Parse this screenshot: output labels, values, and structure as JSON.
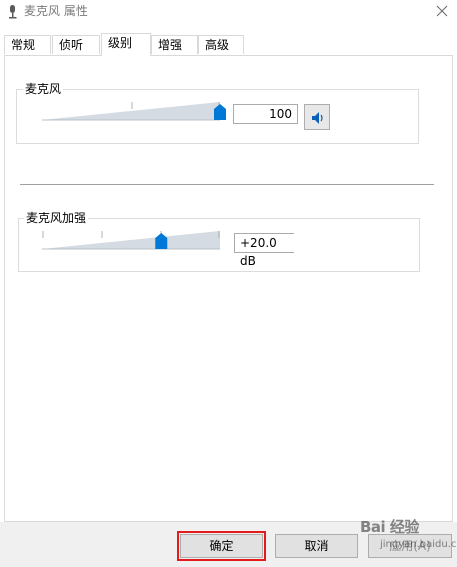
{
  "window": {
    "title": "麦克风 属性"
  },
  "tabs": [
    {
      "label": "常规",
      "active": false
    },
    {
      "label": "侦听",
      "active": false
    },
    {
      "label": "级别",
      "active": true
    },
    {
      "label": "增强",
      "active": false
    },
    {
      "label": "高级",
      "active": false
    }
  ],
  "microphone": {
    "label": "麦克风",
    "value": "100",
    "level": 1.0,
    "mute_icon": "speaker-icon"
  },
  "boost": {
    "label": "麦克风加强",
    "value": "+20.0 dB",
    "level": 0.67
  },
  "buttons": {
    "ok": "确定",
    "cancel": "取消",
    "apply": "应用(A)"
  },
  "watermark": {
    "main": "Bai 经验",
    "sub": "jingyan.baidu.com"
  },
  "colors": {
    "accent": "#0078d7",
    "highlight": "#e21c1c"
  }
}
